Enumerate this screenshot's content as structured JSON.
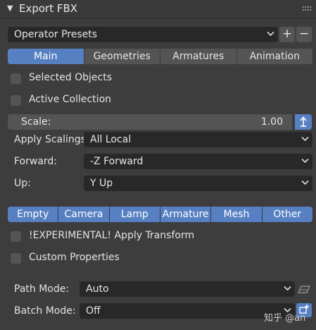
{
  "panel": {
    "title": "Export FBX"
  },
  "presets": {
    "value": "Operator Presets",
    "add": "+",
    "remove": "−"
  },
  "main_tabs": [
    {
      "label": "Main",
      "active": true
    },
    {
      "label": "Geometries",
      "active": false
    },
    {
      "label": "Armatures",
      "active": false
    },
    {
      "label": "Animation",
      "active": false
    }
  ],
  "checkboxes_top": [
    {
      "label": "Selected Objects",
      "checked": false
    },
    {
      "label": "Active Collection",
      "checked": false
    }
  ],
  "scale": {
    "label": "Scale:",
    "value": "1.00"
  },
  "apply_scalings": {
    "label": "Apply Scalings:",
    "value": "All Local"
  },
  "forward": {
    "label": "Forward:",
    "value": "-Z Forward"
  },
  "up": {
    "label": "Up:",
    "value": "Y Up"
  },
  "object_types": [
    "Empty",
    "Camera",
    "Lamp",
    "Armature",
    "Mesh",
    "Other"
  ],
  "checkboxes_bottom": [
    {
      "label": "!EXPERIMENTAL! Apply Transform",
      "checked": false
    },
    {
      "label": "Custom Properties",
      "checked": false
    }
  ],
  "path_mode": {
    "label": "Path Mode:",
    "value": "Auto"
  },
  "batch_mode": {
    "label": "Batch Mode:",
    "value": "Off"
  },
  "watermark": "知乎 @an",
  "colors": {
    "accent": "#5680c2",
    "panel_bg": "#3d3d3d",
    "field_bg": "#282828",
    "button_bg": "#545454"
  }
}
